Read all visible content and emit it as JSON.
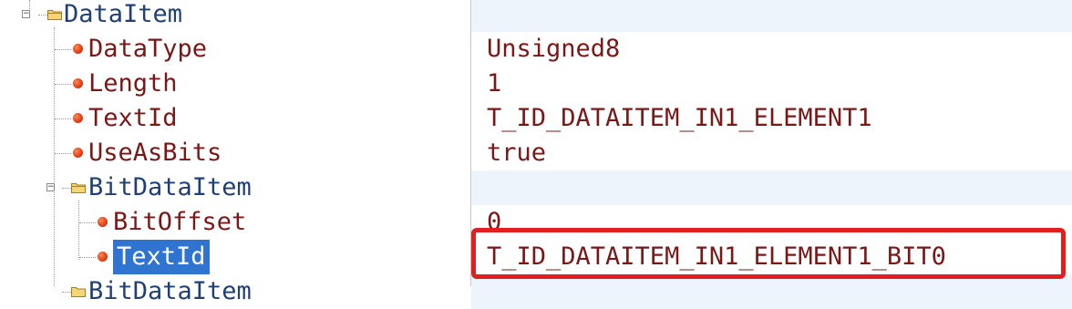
{
  "tree": {
    "items": [
      {
        "label": "DataItem",
        "kind": "folder",
        "level": 0
      },
      {
        "label": "DataType",
        "kind": "leaf",
        "level": 1
      },
      {
        "label": "Length",
        "kind": "leaf",
        "level": 1
      },
      {
        "label": "TextId",
        "kind": "leaf",
        "level": 1
      },
      {
        "label": "UseAsBits",
        "kind": "leaf",
        "level": 1
      },
      {
        "label": "BitDataItem",
        "kind": "folder",
        "level": 1
      },
      {
        "label": "BitOffset",
        "kind": "leaf",
        "level": 2
      },
      {
        "label": "TextId",
        "kind": "leaf",
        "level": 2,
        "selected": true
      },
      {
        "label": "BitDataItem",
        "kind": "folder",
        "level": 1
      }
    ]
  },
  "values": {
    "rows": [
      "",
      "Unsigned8",
      "1",
      "T_ID_DATAITEM_IN1_ELEMENT1",
      "true",
      "",
      "0",
      "T_ID_DATAITEM_IN1_ELEMENT1_BIT0",
      ""
    ]
  },
  "colors": {
    "text": "#7a1717",
    "node_text": "#1f3f75",
    "selection": "#2f74d0",
    "highlight_border": "#e21f1f",
    "row_shade": "#eef4fb"
  },
  "icons": {
    "folder": "folder-icon",
    "leaf": "property-bullet-icon",
    "expander": "collapse-icon"
  }
}
